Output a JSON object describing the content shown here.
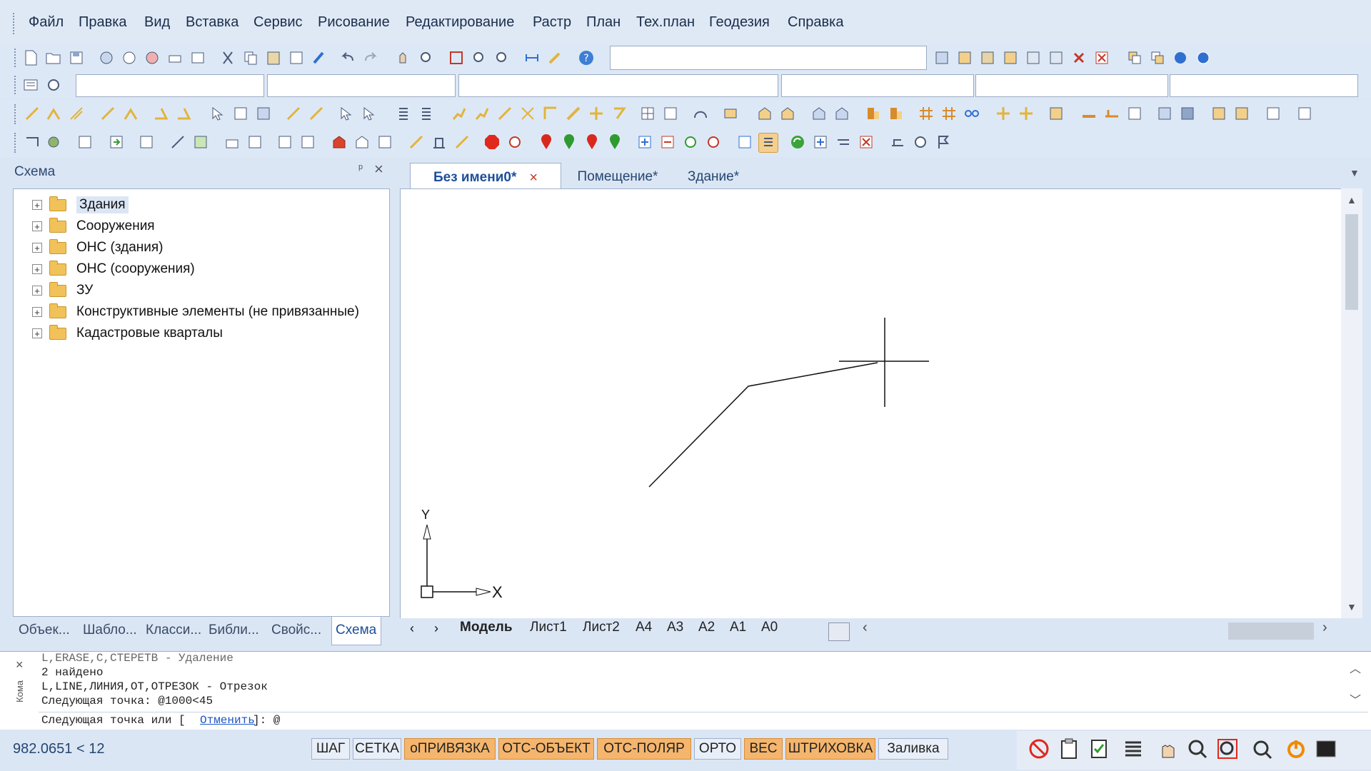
{
  "menu": [
    "Файл",
    "Правка",
    "Вид",
    "Вставка",
    "Сервис",
    "Рисование",
    "Редактирование",
    "Растр",
    "План",
    "Тех.план",
    "Геодезия",
    "Справка"
  ],
  "panel": {
    "title": "Схема",
    "pin_glyph": "ᵖ",
    "close_glyph": "×",
    "tree": [
      "Здания",
      "Сооружения",
      "ОНС (здания)",
      "ОНС (сооружения)",
      "ЗУ",
      "Конструктивные элементы (не привязанные)",
      "Кадастровые кварталы"
    ],
    "tabs": [
      "Объек...",
      "Шабло...",
      "Класси...",
      "Библи...",
      "Свойс...",
      "Схема"
    ],
    "active_tab": "Схема"
  },
  "doc_tabs": [
    {
      "label": "Без имени0*",
      "active": true
    },
    {
      "label": "Помещение*",
      "active": false
    },
    {
      "label": "Здание*",
      "active": false
    }
  ],
  "doc_tab_close": "×",
  "sheets": [
    "Модель",
    "Лист1",
    "Лист2",
    "А4",
    "А3",
    "А2",
    "А1",
    "А0"
  ],
  "ucs": {
    "y": "Y",
    "x": "X"
  },
  "command": {
    "lines": [
      "L,ERASE,C,CTEPETB - Удаление",
      "2 найдено",
      "L,LINE,ЛИНИЯ,ОТ,ОТРЕЗОК - Отрезок",
      "Следующая точка: @1000<45"
    ],
    "prompt_prefix": "Следующая точка или [",
    "prompt_link": "Отменить",
    "prompt_suffix": "]: @",
    "side_label": "Кома"
  },
  "status": {
    "coords": "982.0651 < 12",
    "buttons": [
      {
        "label": "ШАГ",
        "on": false
      },
      {
        "label": "СЕТКА",
        "on": false
      },
      {
        "label": "оПРИВЯЗКА",
        "on": true
      },
      {
        "label": "ОТС-ОБЪЕКТ",
        "on": true
      },
      {
        "label": "ОТС-ПОЛЯР",
        "on": true
      },
      {
        "label": "ОРТО",
        "on": false
      },
      {
        "label": "ВЕС",
        "on": true
      },
      {
        "label": "ШТРИХОВКА",
        "on": true
      },
      {
        "label": "Заливка",
        "on": false
      }
    ]
  },
  "colors": {
    "accent": "#f5b56c",
    "link": "#1a55c4",
    "tab_active_text": "#1d4f9a"
  }
}
